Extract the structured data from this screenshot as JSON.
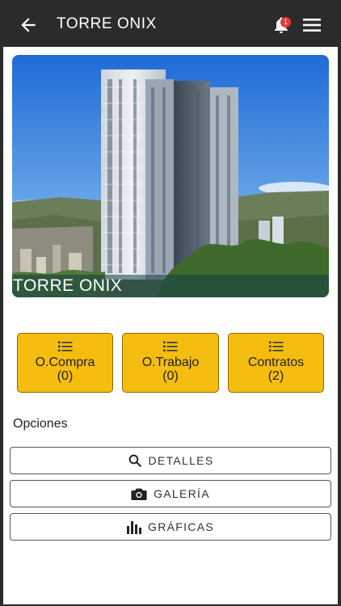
{
  "header": {
    "title": "TORRE ONIX",
    "notification_count": "1"
  },
  "hero": {
    "caption": "TORRE ONIX"
  },
  "cards": [
    {
      "label": "O.Compra",
      "count": "(0)",
      "icon": "list-icon"
    },
    {
      "label": "O.Trabajo",
      "count": "(0)",
      "icon": "list-icon"
    },
    {
      "label": "Contratos",
      "count": "(2)",
      "icon": "list-icon"
    }
  ],
  "options": {
    "title": "Opciones",
    "buttons": [
      {
        "label": "DETALLES",
        "icon": "search-icon"
      },
      {
        "label": "GALERÍA",
        "icon": "camera-icon"
      },
      {
        "label": "GRÁFICAS",
        "icon": "bar-chart-icon"
      }
    ]
  },
  "colors": {
    "app_bar": "#2b2b2b",
    "card": "#f5bd0f",
    "badge": "#e53935"
  }
}
